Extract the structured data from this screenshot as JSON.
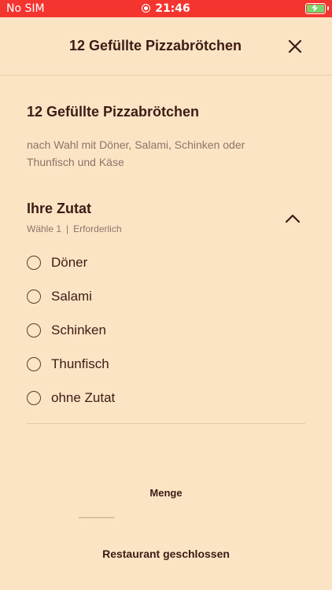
{
  "status_bar": {
    "carrier": "No SIM",
    "time": "21:46"
  },
  "header": {
    "title": "12 Gefüllte Pizzabrötchen",
    "close_icon": "close-icon"
  },
  "product": {
    "title": "12 Gefüllte Pizzabrötchen",
    "description": "nach Wahl mit Döner, Salami, Schinken oder Thunfisch und Käse"
  },
  "section": {
    "title": "Ihre Zutat",
    "choice_text": "Wähle 1",
    "separator": "|",
    "required_text": "Erforderlich",
    "options": [
      {
        "label": "Döner"
      },
      {
        "label": "Salami"
      },
      {
        "label": "Schinken"
      },
      {
        "label": "Thunfisch"
      },
      {
        "label": "ohne Zutat"
      }
    ]
  },
  "quantity": {
    "label": "Menge"
  },
  "footer": {
    "button_label": "Restaurant geschlossen"
  },
  "colors": {
    "background": "#fbe4c4",
    "status_bar": "#f4352f",
    "text_primary": "#3d1c15",
    "text_secondary": "#8a756a",
    "battery_fill": "#7ed46c"
  }
}
